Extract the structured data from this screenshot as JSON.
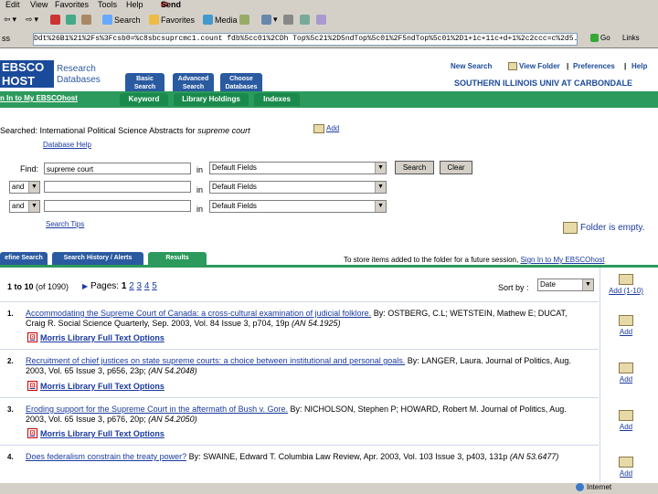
{
  "browser": {
    "menu": [
      "Edit",
      "View",
      "Favorites",
      "Tools",
      "Help"
    ],
    "send_label": "Send",
    "toolbar": {
      "search": "Search",
      "favorites": "Favorites",
      "media": "Media"
    },
    "address": "Ddt%26B1%21%2Fs%3Fcsb0=%c8sbcsuprcmc1.count fdb%5cc01%2CDh Top%5c21%2D5ndTop%5c01%2F5ndTop%5c01%2D1+1c+11c+d+1%2c2ccc=c%2d5...",
    "go_label": "Go",
    "links_label": "Links",
    "status": "Internet"
  },
  "header": {
    "logo_top": "EBSCO",
    "logo_bottom": "HOST",
    "logo_sub1": "Research",
    "logo_sub2": "Databases",
    "tabs_top": [
      {
        "l1": "Basic",
        "l2": "Search"
      },
      {
        "l1": "Advanced",
        "l2": "Search"
      },
      {
        "l1": "Choose",
        "l2": "Databases"
      }
    ],
    "subtabs": [
      "Keyword",
      "Library Holdings",
      "Indexes"
    ],
    "signin": "n In to My EBSCOhost",
    "links": [
      "New Search",
      "View Folder",
      "Preferences",
      "Help"
    ],
    "university": "SOUTHERN ILLINOIS UNIV AT CARBONDALE"
  },
  "search": {
    "searched_prefix": "Searched: International Political Science Abstracts for",
    "searched_term": "supreme court",
    "add_label": "Add",
    "db_help": "Database Help",
    "find_label": "Find:",
    "in_label": "in",
    "find_value": "supreme court",
    "field_default": "Default Fields",
    "op": "and",
    "search_btn": "Search",
    "clear_btn": "Clear",
    "tips": "Search Tips",
    "folder_status": "Folder is empty."
  },
  "results_tabs": [
    "efine Search",
    "Search History / Alerts",
    "Results"
  ],
  "folder_notice_prefix": "To store items added to the folder for a future session,",
  "folder_notice_link": "Sign In to My EBSCOhost",
  "results": {
    "range": "1 to 10",
    "total": "(of 1090)",
    "pages_label": "Pages:",
    "pages_current": "1",
    "pages_links": [
      "2",
      "3",
      "4",
      "5"
    ],
    "next_arrow": "▶",
    "sort_label": "Sort by :",
    "sort_value": "Date",
    "add_range": "Add (1-10)",
    "add_label": "Add",
    "fulltext": "Morris Library Full Text Options",
    "items": [
      {
        "n": "1.",
        "title": "Accommodating the Supreme Court of Canada: a cross-cultural examination of judicial folklore.",
        "rest": " By: OSTBERG, C.L; WETSTEIN, Mathew E; DUCAT, Craig R. Social Science Quarterly, Sep. 2003, Vol. 84 Issue 3, p704, 19p",
        "an": "(AN 54.1925)"
      },
      {
        "n": "2.",
        "title": "Recruitment of chief justices on state supreme courts: a choice between institutional and personal goals.",
        "rest": " By: LANGER, Laura. Journal of Politics, Aug. 2003, Vol. 65 Issue 3, p656, 23p;",
        "an": "(AN 54.2048)"
      },
      {
        "n": "3.",
        "title": "Eroding support for the Supreme Court in the aftermath of Bush v. Gore.",
        "rest": " By: NICHOLSON, Stephen P; HOWARD, Robert M. Journal of Politics, Aug. 2003, Vol. 65 Issue 3, p676, 20p;",
        "an": "(AN 54.2050)"
      },
      {
        "n": "4.",
        "title": "Does federalism constrain the treaty power?",
        "rest": " By: SWAINE, Edward T. Columbia Law Review, Apr. 2003, Vol. 103 Issue 3, p403, 131p",
        "an": "(AN 53.6477)"
      }
    ]
  },
  "colors": {
    "blue": "#2a5aa0",
    "green": "#2c9a5c",
    "link": "#1a3aa0"
  }
}
